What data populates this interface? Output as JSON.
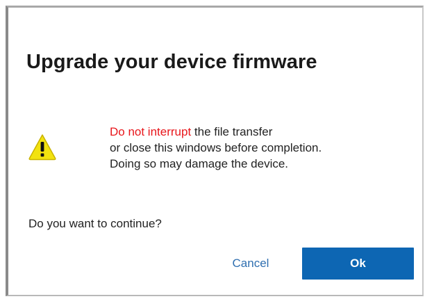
{
  "dialog": {
    "title": "Upgrade your device firmware",
    "warning": {
      "icon": "warning-triangle-icon",
      "highlight": "Do not interrupt",
      "line1_rest": " the file transfer",
      "line2": "or close this windows before completion.",
      "line3": "Doing so may damage the device.",
      "highlight_color": "#e8161b"
    },
    "question": "Do you want to continue?",
    "buttons": {
      "cancel_label": "Cancel",
      "ok_label": "Ok"
    },
    "colors": {
      "primary": "#0d66b3",
      "link": "#2f6fb0",
      "icon_fill": "#f2e20f"
    }
  }
}
